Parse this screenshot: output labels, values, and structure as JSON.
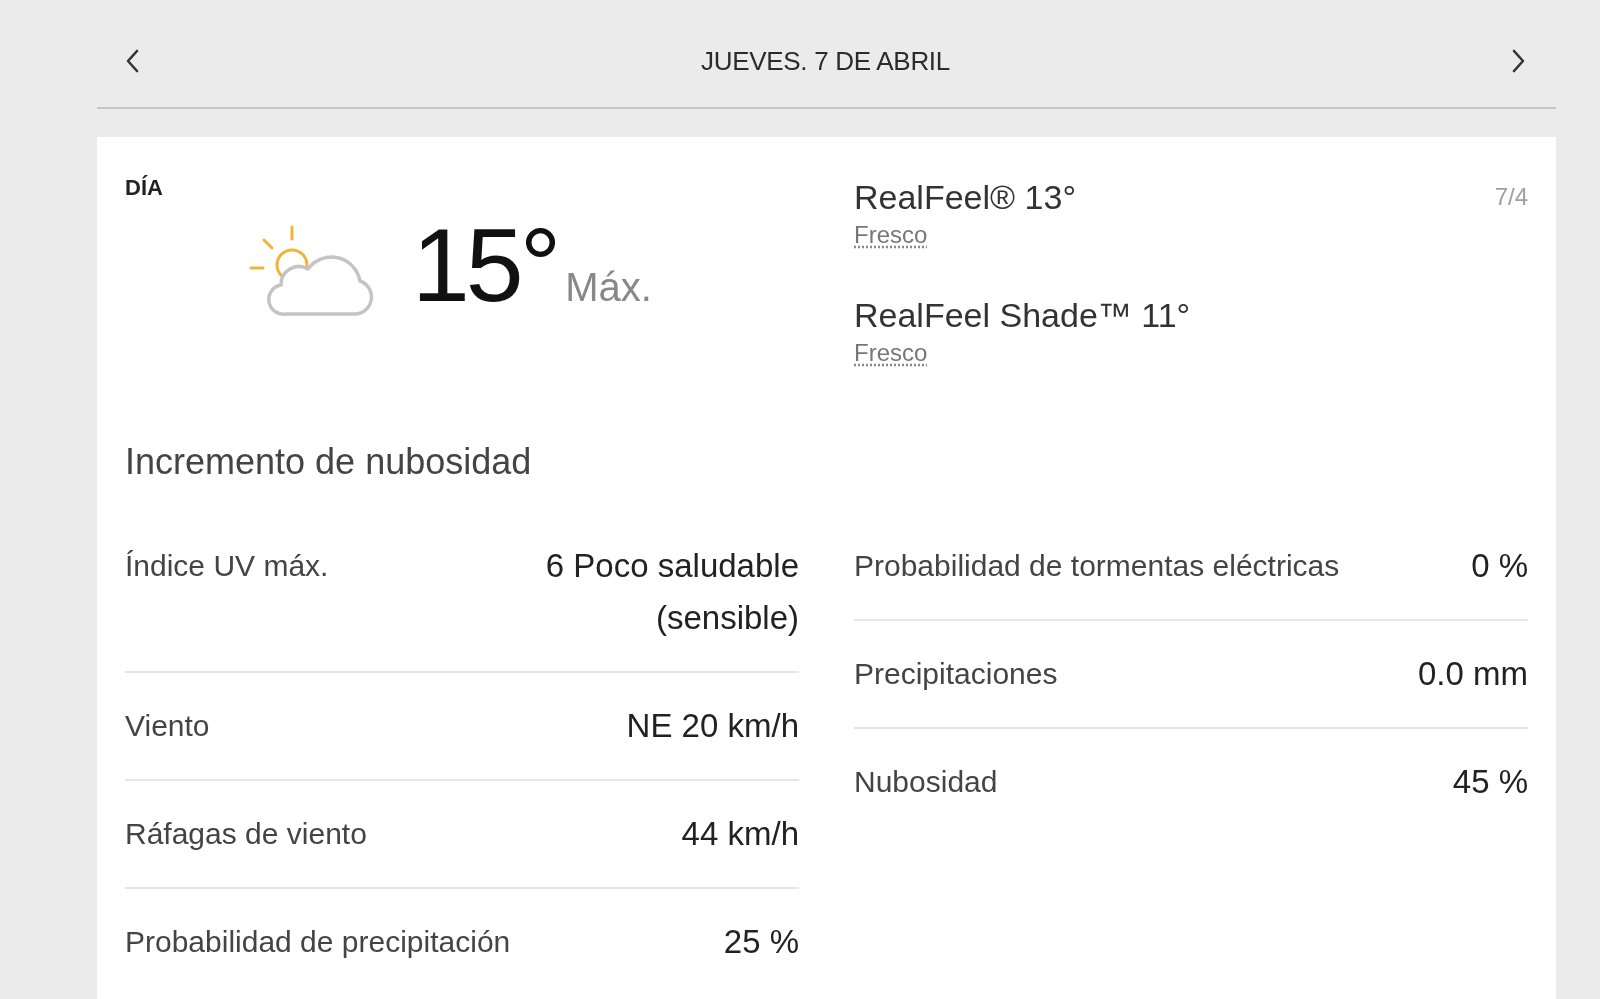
{
  "header": {
    "title": "JUEVES. 7 DE ABRIL"
  },
  "day": {
    "label": "DÍA",
    "temperature": "15°",
    "temperature_label": "Máx.",
    "date": "7/4",
    "realfeel": [
      {
        "label": "RealFeel® 13°",
        "phrase": "Fresco"
      },
      {
        "label": "RealFeel Shade™ 11°",
        "phrase": "Fresco"
      }
    ],
    "phrase": "Incremento de nubosidad"
  },
  "details_left": [
    {
      "label": "Índice UV máx.",
      "value": "6 Poco saludable (sensible)"
    },
    {
      "label": "Viento",
      "value": "NE 20 km/h"
    },
    {
      "label": "Ráfagas de viento",
      "value": "44 km/h"
    },
    {
      "label": "Probabilidad de precipitación",
      "value": "25 %"
    }
  ],
  "details_right": [
    {
      "label": "Probabilidad de tormentas eléctricas",
      "value": "0 %"
    },
    {
      "label": "Precipitaciones",
      "value": "0.0 mm"
    },
    {
      "label": "Nubosidad",
      "value": "45 %"
    }
  ]
}
